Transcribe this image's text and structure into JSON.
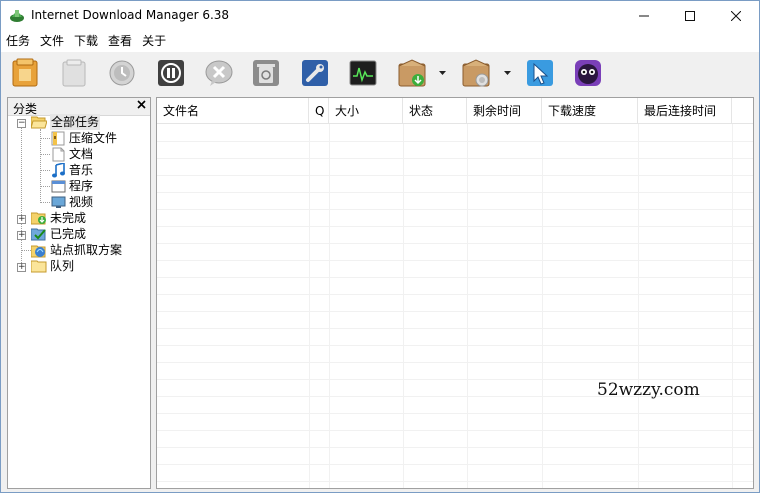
{
  "window": {
    "title": "Internet Download Manager 6.38",
    "controls": {
      "minimize_icon": "minimize-icon",
      "maximize_icon": "maximize-icon",
      "close_icon": "close-icon"
    }
  },
  "menu": {
    "items": [
      {
        "label": "任务"
      },
      {
        "label": "文件"
      },
      {
        "label": "下载"
      },
      {
        "label": "查看"
      },
      {
        "label": "关于"
      }
    ]
  },
  "toolbar": {
    "buttons": [
      {
        "icon": "add-url-icon",
        "color": "#e8a23a"
      },
      {
        "icon": "resume-icon",
        "color": "#c8c8c8"
      },
      {
        "icon": "stop-icon",
        "color": "#bdbdbd"
      },
      {
        "icon": "stop-all-icon",
        "color": "#404040"
      },
      {
        "icon": "delete-icon",
        "color": "#b5b5b5"
      },
      {
        "icon": "delete-completed-icon",
        "color": "#9a9a9a"
      },
      {
        "icon": "options-icon",
        "color": "#2f5fa8"
      },
      {
        "icon": "scheduler-icon",
        "color": "#1e1e1e"
      },
      {
        "icon": "start-queue-icon",
        "color": "#b98550"
      },
      {
        "icon": "stop-queue-icon",
        "color": "#b98550"
      },
      {
        "icon": "grabber-icon",
        "color": "#3a9be0"
      },
      {
        "icon": "tell-friend-icon",
        "color": "#7a3fb8"
      }
    ]
  },
  "sidebar": {
    "title": "分类",
    "close_icon": "close-icon",
    "tree": {
      "all": {
        "label": "全部任务"
      },
      "children": [
        {
          "label": "压缩文件",
          "icon": "archive-icon"
        },
        {
          "label": "文档",
          "icon": "document-icon"
        },
        {
          "label": "音乐",
          "icon": "music-icon"
        },
        {
          "label": "程序",
          "icon": "program-icon"
        },
        {
          "label": "视频",
          "icon": "video-icon"
        }
      ],
      "unfinished": {
        "label": "未完成"
      },
      "finished": {
        "label": "已完成"
      },
      "grabber": {
        "label": "站点抓取方案"
      },
      "queues": {
        "label": "队列"
      }
    }
  },
  "list": {
    "columns": [
      {
        "label": "文件名"
      },
      {
        "label": "Q"
      },
      {
        "label": "大小"
      },
      {
        "label": "状态"
      },
      {
        "label": "剩余时间"
      },
      {
        "label": "下载速度"
      },
      {
        "label": "最后连接时间"
      }
    ],
    "rows": []
  },
  "watermark": {
    "text": "52wzzy.com"
  }
}
